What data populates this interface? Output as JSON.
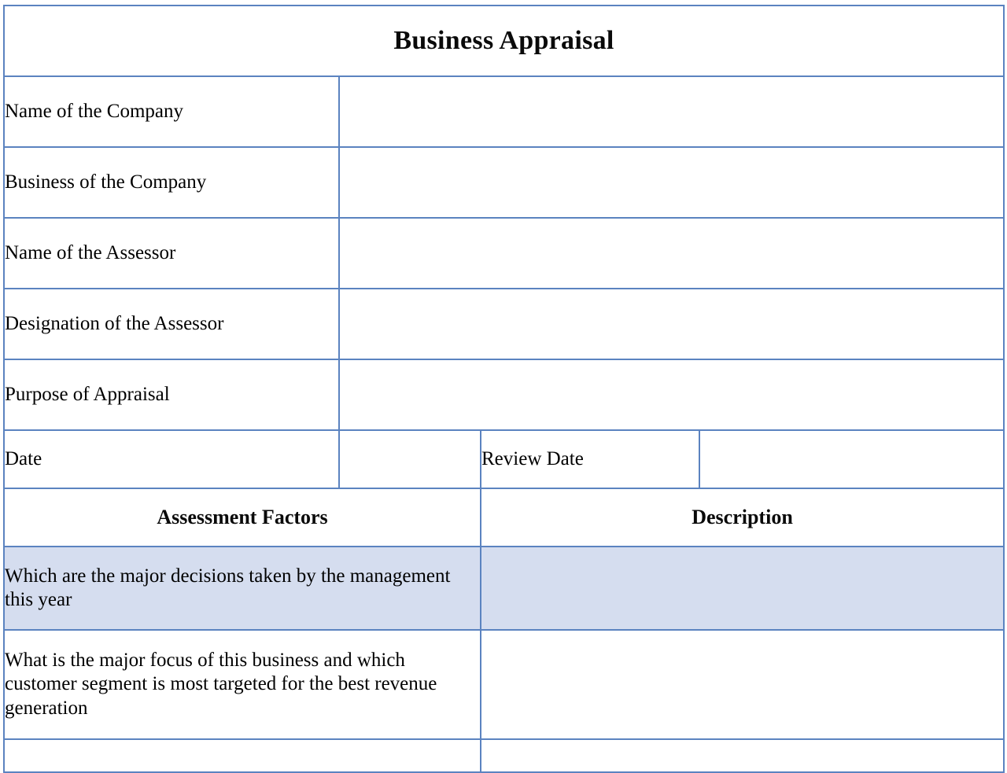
{
  "document": {
    "title": "Business Appraisal"
  },
  "fields": [
    {
      "label": "Name of the Company",
      "value": "",
      "fill": "white"
    },
    {
      "label": "Business of the Company",
      "value": "",
      "fill": "tint"
    },
    {
      "label": "Name of the Assessor",
      "value": "",
      "fill": "white"
    },
    {
      "label": "Designation of the Assessor",
      "value": "",
      "fill": "tint"
    },
    {
      "label": "Purpose of Appraisal",
      "value": "",
      "fill": "white"
    }
  ],
  "date_row": {
    "date_label": "Date",
    "date_value": "",
    "review_date_label": "Review Date",
    "review_date_value": ""
  },
  "assessment": {
    "col_factors": "Assessment Factors",
    "col_description": "Description",
    "rows": [
      {
        "factor": "Which are the major decisions taken by the management this year",
        "description": "",
        "fill": "tint"
      },
      {
        "factor": "What is the major focus of this business and which customer segment is most targeted for the best revenue generation",
        "description": "",
        "fill": "white"
      }
    ]
  },
  "colors": {
    "header_blue": "#94B0D8",
    "tint_blue": "#D5DDEF",
    "border_blue": "#5B83C0",
    "white": "#FFFFFF",
    "text": "#000000"
  }
}
